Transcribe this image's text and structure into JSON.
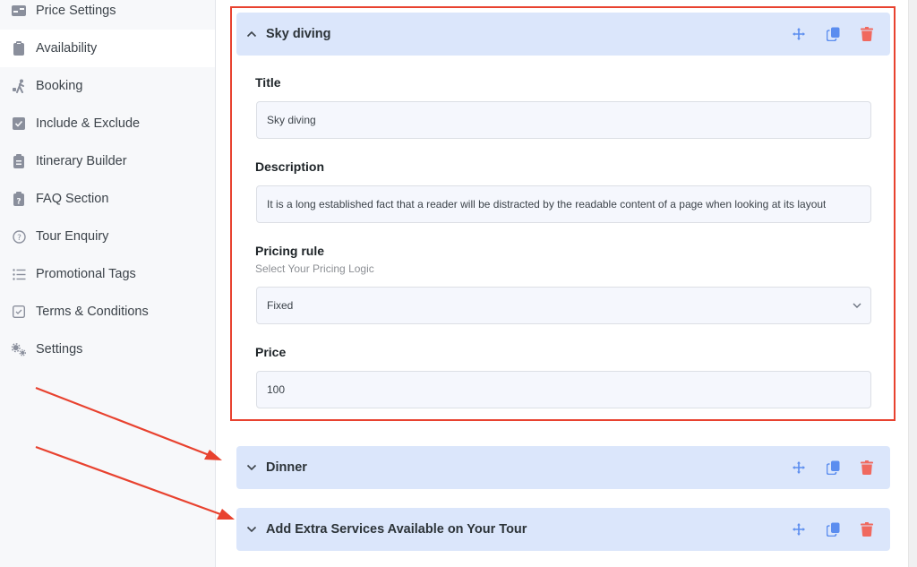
{
  "sidebar": {
    "items": [
      {
        "label": "Price Settings",
        "icon": "id-card-icon"
      },
      {
        "label": "Availability",
        "icon": "clipboard-icon",
        "active": true
      },
      {
        "label": "Booking",
        "icon": "person-walking-luggage-icon"
      },
      {
        "label": "Include & Exclude",
        "icon": "check-square-icon"
      },
      {
        "label": "Itinerary Builder",
        "icon": "clipboard-list-icon"
      },
      {
        "label": "FAQ Section",
        "icon": "clipboard-question-icon"
      },
      {
        "label": "Tour Enquiry",
        "icon": "question-circle-icon"
      },
      {
        "label": "Promotional Tags",
        "icon": "list-icon"
      },
      {
        "label": "Terms & Conditions",
        "icon": "checkbox-outline-icon"
      },
      {
        "label": "Settings",
        "icon": "gears-icon"
      }
    ]
  },
  "services": [
    {
      "title": "Sky diving",
      "expanded": true,
      "fields": {
        "title_label": "Title",
        "title_value": "Sky diving",
        "description_label": "Description",
        "description_value": "It is a long established fact that a reader will be distracted by the readable content of a page when looking at its layout",
        "pricing_rule_label": "Pricing rule",
        "pricing_rule_hint": "Select Your Pricing Logic",
        "pricing_rule_value": "Fixed",
        "price_label": "Price",
        "price_value": "100"
      }
    },
    {
      "title": "Dinner",
      "expanded": false
    },
    {
      "title": "Add Extra Services Available on Your Tour",
      "expanded": false
    }
  ],
  "actions": {
    "move": "move-icon",
    "duplicate": "copy-icon",
    "delete": "trash-icon"
  },
  "colors": {
    "panel_bg": "#dbe6fb",
    "action_blue": "#5b8def",
    "delete_red": "#f0695f",
    "annotation_red": "#e8422f"
  }
}
